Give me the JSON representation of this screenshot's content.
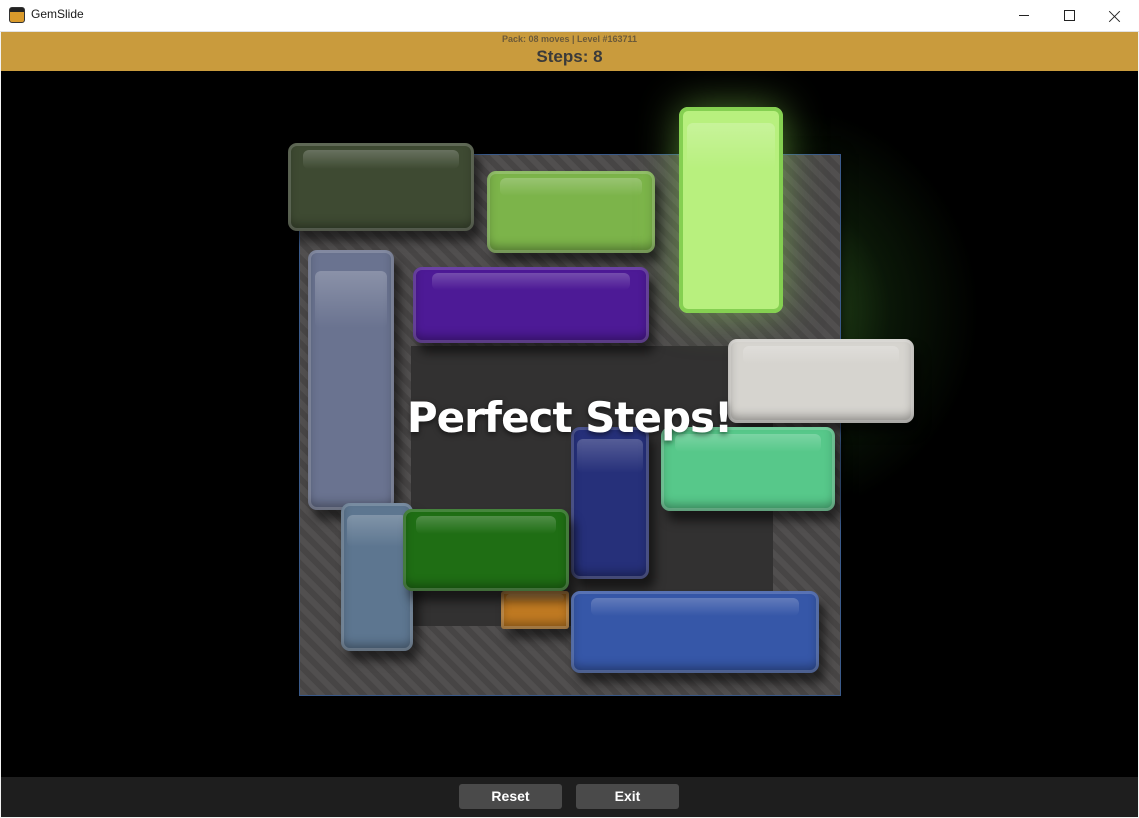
{
  "window": {
    "title": "GemSlide",
    "app_icon": "gem-app-icon",
    "controls": [
      "minimize-icon",
      "maximize-icon",
      "close-icon"
    ]
  },
  "header": {
    "pack_info": "Pack: 08 moves | Level #163711",
    "steps": "Steps: 8",
    "background_color": "#c99b3d"
  },
  "game": {
    "message": "Perfect Steps!",
    "blocks": [
      {
        "color": "#3e4a32",
        "name": "olive"
      },
      {
        "color": "#7cb44a",
        "name": "lime"
      },
      {
        "color": "#b8f07e",
        "name": "light-green"
      },
      {
        "color": "#4d1a96",
        "name": "purple"
      },
      {
        "color": "#6a7390",
        "name": "slate"
      },
      {
        "color": "#d6d4cf",
        "name": "white"
      },
      {
        "color": "#57c88a",
        "name": "mint"
      },
      {
        "color": "#26307a",
        "name": "navy"
      },
      {
        "color": "#5d7690",
        "name": "steel"
      },
      {
        "color": "#1f6e14",
        "name": "green"
      },
      {
        "color": "#c07a22",
        "name": "orange"
      },
      {
        "color": "#3657a8",
        "name": "blue"
      }
    ]
  },
  "footer": {
    "reset_label": "Reset",
    "exit_label": "Exit"
  }
}
